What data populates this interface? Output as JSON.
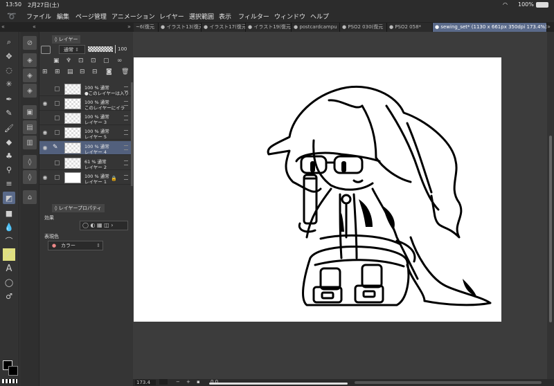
{
  "status": {
    "time": "13:50",
    "date": "2月27日(土)",
    "battery": "100%"
  },
  "menu": [
    "ファイル",
    "編集",
    "ページ管理",
    "アニメーション",
    "レイヤー",
    "選択範囲",
    "表示",
    "フィルター",
    "ウィンドウ",
    "ヘルプ"
  ],
  "tabs": [
    {
      "label": "~6(復元"
    },
    {
      "label": "● イラスト13(復元"
    },
    {
      "label": "● イラスト17(復元"
    },
    {
      "label": "● イラスト19(復元"
    },
    {
      "label": "● postcardcampu"
    },
    {
      "label": "● PSO2 030(復元"
    },
    {
      "label": "● PSO2 058*"
    },
    {
      "label": "● sewing_set* (1130 x 661px 350dpi 173.4%)"
    }
  ],
  "layer_panel": {
    "tab": "レイヤー",
    "blend_mode": "通常",
    "opacity": "100",
    "layers": [
      {
        "line1": "100 % 通常",
        "line2": "●このレイヤーは入り",
        "visible": false
      },
      {
        "line1": "100 % 通常",
        "line2": "このレイヤーにイラ",
        "visible": true
      },
      {
        "line1": "100 % 通常",
        "line2": "レイヤー 3",
        "visible": false
      },
      {
        "line1": "100 % 通常",
        "line2": "レイヤー 5",
        "visible": true
      },
      {
        "line1": "100 % 通常",
        "line2": "レイヤー 4",
        "visible": true,
        "selected": true
      },
      {
        "line1": "61 % 通常",
        "line2": "レイヤー 2",
        "visible": false
      },
      {
        "line1": "100 % 通常",
        "line2": "レイヤー 1",
        "visible": true,
        "white": true
      }
    ]
  },
  "property_panel": {
    "tab": "レイヤープロパティ",
    "effect_label": "効果",
    "expression_label": "表現色",
    "expression_value": "カラー"
  },
  "bottom": {
    "zoom": "173.4",
    "value": "0.0"
  },
  "colors": {
    "accent": "#5a6a8a",
    "panel": "#353535"
  }
}
